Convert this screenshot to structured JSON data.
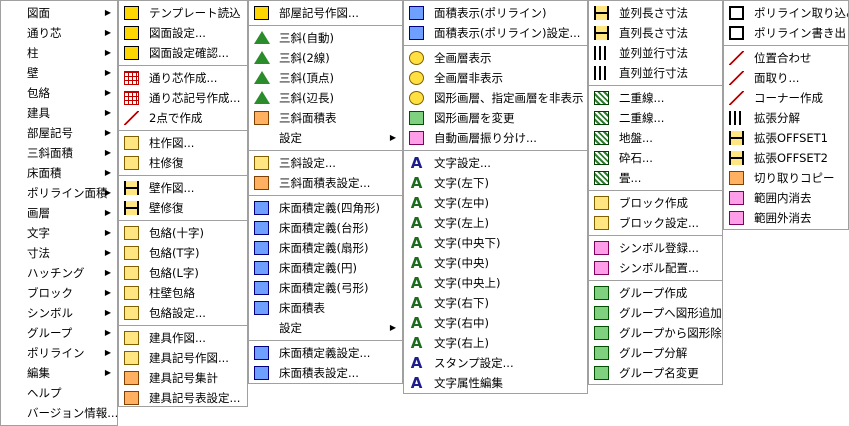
{
  "main_menu": [
    {
      "label": "図面",
      "sub": true
    },
    {
      "label": "通り芯",
      "sub": true
    },
    {
      "label": "柱",
      "sub": true
    },
    {
      "label": "壁",
      "sub": true
    },
    {
      "label": "包絡",
      "sub": true
    },
    {
      "label": "建具",
      "sub": true
    },
    {
      "label": "部屋記号",
      "sub": true
    },
    {
      "label": "三斜面積",
      "sub": true
    },
    {
      "label": "床面積",
      "sub": true
    },
    {
      "label": "ポリライン面積",
      "sub": true
    },
    {
      "label": "画層",
      "sub": true
    },
    {
      "label": "文字",
      "sub": true
    },
    {
      "label": "寸法",
      "sub": true
    },
    {
      "label": "ハッチング",
      "sub": true
    },
    {
      "label": "ブロック",
      "sub": true
    },
    {
      "label": "シンボル",
      "sub": true
    },
    {
      "label": "グループ",
      "sub": true
    },
    {
      "label": "ポリライン",
      "sub": true
    },
    {
      "label": "編集",
      "sub": true
    },
    {
      "label": "ヘルプ",
      "sub": false
    },
    {
      "label": "バージョン情報...",
      "sub": false
    }
  ],
  "col1": {
    "g1": [
      "テンプレート読込",
      "図面設定...",
      "図面設定確認..."
    ],
    "g2": [
      "通り芯作成...",
      "通り芯記号作成...",
      "2点で作成"
    ],
    "g3": [
      "柱作図...",
      "柱修復"
    ],
    "g4": [
      "壁作図...",
      "壁修復"
    ],
    "g5": [
      "包絡(十字)",
      "包絡(T字)",
      "包絡(L字)",
      "柱壁包絡",
      "包絡設定..."
    ],
    "g6": [
      "建具作図...",
      "建具記号作図...",
      "建具記号集計",
      "建具記号表設定..."
    ]
  },
  "col2": {
    "g1": [
      "部屋記号作図..."
    ],
    "g2": [
      "三斜(自動)",
      "三斜(2線)",
      "三斜(頂点)",
      "三斜(辺長)",
      "三斜面積表",
      "設定"
    ],
    "g3": [
      "三斜設定...",
      "三斜面積表設定..."
    ],
    "g4": [
      "床面積定義(四角形)",
      "床面積定義(台形)",
      "床面積定義(扇形)",
      "床面積定義(円)",
      "床面積定義(弓形)",
      "床面積表",
      "設定"
    ],
    "g5": [
      "床面積定義設定...",
      "床面積表設定..."
    ]
  },
  "col3": {
    "g1": [
      "面積表示(ポリライン)",
      "面積表示(ポリライン)設定..."
    ],
    "g2": [
      "全画層表示",
      "全画層非表示",
      "図形画層、指定画層を非表示",
      "図形画層を変更",
      "自動画層振り分け..."
    ],
    "g3": [
      "文字設定...",
      "文字(左下)",
      "文字(左中)",
      "文字(左上)",
      "文字(中央下)",
      "文字(中央)",
      "文字(中央上)",
      "文字(右下)",
      "文字(右中)",
      "文字(右上)",
      "スタンプ設定...",
      "文字属性編集"
    ]
  },
  "col4": {
    "g1": [
      "並列長さ寸法",
      "直列長さ寸法",
      "並列並行寸法",
      "直列並行寸法"
    ],
    "g2": [
      "二重線...",
      "二重線...",
      "地盤...",
      "砕石...",
      "畳..."
    ],
    "g3": [
      "ブロック作成",
      "ブロック設定..."
    ],
    "g4": [
      "シンボル登録...",
      "シンボル配置..."
    ],
    "g5": [
      "グループ作成",
      "グループへ図形追加",
      "グループから図形除外",
      "グループ分解",
      "グループ名変更"
    ]
  },
  "col5": {
    "g1": [
      "ポリライン取り込み...",
      "ポリライン書き出し"
    ],
    "g2": [
      "位置合わせ",
      "面取り...",
      "コーナー作成",
      "拡張分解",
      "拡張OFFSET1",
      "拡張OFFSET2",
      "切り取りコピー",
      "範囲内消去",
      "範囲外消去"
    ]
  },
  "arrow_glyph": "▶"
}
